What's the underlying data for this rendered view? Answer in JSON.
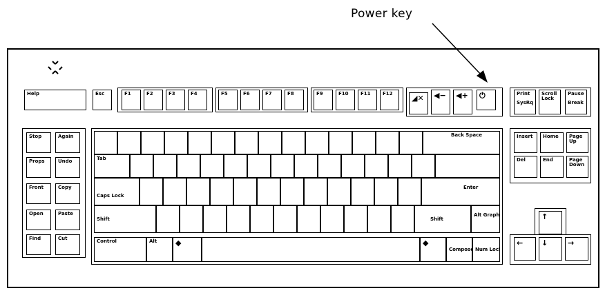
{
  "callout": "Power key",
  "keys": {
    "help": "Help",
    "esc": "Esc",
    "f1": "F1",
    "f2": "F2",
    "f3": "F3",
    "f4": "F4",
    "f5": "F5",
    "f6": "F6",
    "f7": "F7",
    "f8": "F8",
    "f9": "F9",
    "f10": "F10",
    "f11": "F11",
    "f12": "F12",
    "print": "Print",
    "sysrq": "SysRq",
    "scroll": "Scroll",
    "lock": "Lock",
    "pause": "Pause",
    "break": "Break",
    "stop": "Stop",
    "again": "Again",
    "props": "Props",
    "undo": "Undo",
    "front": "Front",
    "copy": "Copy",
    "open": "Open",
    "paste": "Paste",
    "find": "Find",
    "cut": "Cut",
    "backspace": "Back Space",
    "tab": "Tab",
    "capslock": "Caps Lock",
    "enter": "Enter",
    "shift_l": "Shift",
    "shift_r": "Shift",
    "altgraph": "Alt Graph",
    "control": "Control",
    "alt": "Alt",
    "compose": "Compose",
    "numlock": "Num Lock",
    "insert": "Insert",
    "home": "Home",
    "pageup": "Page Up",
    "delete": "Del",
    "end": "End",
    "pagedown": "Page Down"
  }
}
